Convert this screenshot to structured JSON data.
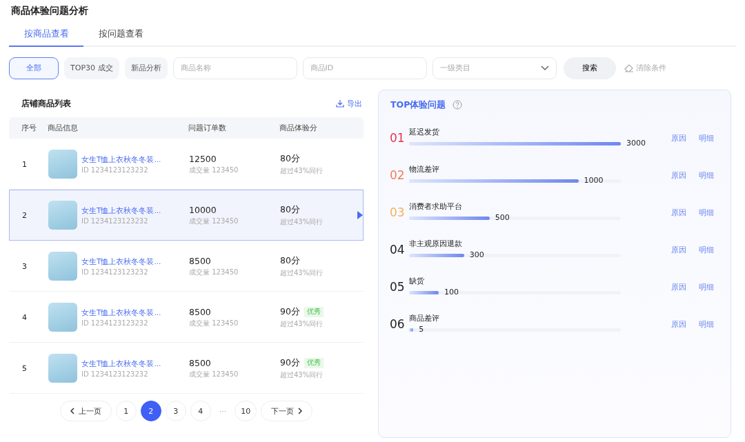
{
  "page_title": "商品体验问题分析",
  "tabs": [
    {
      "label": "按商品查看",
      "selected": true
    },
    {
      "label": "按问题查看",
      "selected": false
    }
  ],
  "filters": {
    "chips": [
      {
        "label": "全部",
        "selected": true
      },
      {
        "label": "TOP30 成交",
        "selected": false
      },
      {
        "label": "新品分析",
        "selected": false
      }
    ],
    "name_field": {
      "placeholder": "商品名称"
    },
    "id_field": {
      "placeholder": "商品ID"
    },
    "category_select": {
      "placeholder": "一级类目"
    },
    "search_button": "搜索",
    "clear_link": "清除条件"
  },
  "product_list": {
    "title": "店铺商品列表",
    "export_link": "导出",
    "columns": [
      "序号",
      "商品信息",
      "问题订单数",
      "商品体验分"
    ],
    "rows": [
      {
        "index": "1",
        "name": "女生T恤上衣秋冬冬装...",
        "id": "ID 1234123123232",
        "orders": "12500",
        "sales": "成交量 123450",
        "score": "80分",
        "compare": "超过43%同行",
        "selected": false
      },
      {
        "index": "2",
        "name": "女生T恤上衣秋冬冬装...",
        "id": "ID 1234123123232",
        "orders": "10000",
        "sales": "成交量 123450",
        "score": "80分",
        "compare": "超过43%同行",
        "selected": true
      },
      {
        "index": "3",
        "name": "女生T恤上衣秋冬冬装...",
        "id": "ID 1234123123232",
        "orders": "8500",
        "sales": "成交量 123450",
        "score": "80分",
        "compare": "超过43%同行",
        "selected": false
      },
      {
        "index": "4",
        "name": "女生T恤上衣秋冬冬装...",
        "id": "ID 1234123123232",
        "orders": "8500",
        "sales": "成交量 123450",
        "score": "90分",
        "badge": "优秀",
        "compare": "超过43%同行",
        "selected": false
      },
      {
        "index": "5",
        "name": "女生T恤上衣秋冬冬装...",
        "id": "ID 1234123123232",
        "orders": "8500",
        "sales": "成交量 123450",
        "score": "90分",
        "badge": "优秀",
        "compare": "超过43%同行",
        "selected": false
      }
    ],
    "pagination": {
      "prev": "上一页",
      "next": "下一页",
      "pages": [
        {
          "label": "1",
          "selected": false
        },
        {
          "label": "2",
          "selected": true
        },
        {
          "label": "3",
          "selected": false
        },
        {
          "label": "4",
          "selected": false
        },
        {
          "label": "···",
          "kind": "gap"
        },
        {
          "label": "10",
          "selected": false
        }
      ]
    }
  },
  "top_issues": {
    "title": "TOP体验问题",
    "items": [
      {
        "rank": "01",
        "color": "#e8344e",
        "name": "延迟发货",
        "level": 1.0,
        "value": "3000",
        "reason": "原因",
        "detail": "明细"
      },
      {
        "rank": "02",
        "color": "#f07f5c",
        "name": "物流差评",
        "level": 0.8,
        "value": "1000",
        "reason": "原因",
        "detail": "明细"
      },
      {
        "rank": "03",
        "color": "#f2b35c",
        "name": "消费者求助平台",
        "level": 0.38,
        "value": "500",
        "reason": "原因",
        "detail": "明细"
      },
      {
        "rank": "04",
        "color": "#222222",
        "name": "非主观原因退款",
        "level": 0.26,
        "value": "300",
        "reason": "原因",
        "detail": "明细"
      },
      {
        "rank": "05",
        "color": "#222222",
        "name": "缺货",
        "level": 0.14,
        "value": "100",
        "reason": "原因",
        "detail": "明细"
      },
      {
        "rank": "06",
        "color": "#222222",
        "name": "商品差评",
        "level": 0.02,
        "value": "5",
        "reason": "原因",
        "detail": "明细"
      }
    ]
  }
}
